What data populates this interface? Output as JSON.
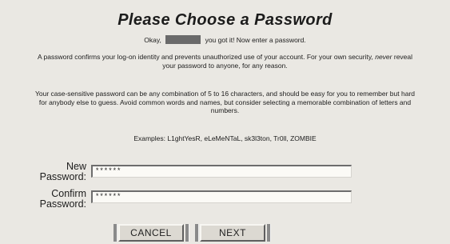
{
  "page": {
    "title": "Please Choose a Password",
    "greeting_prefix": "Okay,",
    "greeting_suffix": "you got it! Now enter a password.",
    "para1_part1": "A password confirms your log-on identity and prevents unauthorized use of your account. For your own security,",
    "para1_emphasis": "never",
    "para1_part2": "reveal your password to anyone, for any reason.",
    "para2": "Your case-sensitive password can be any combination of 5 to 16 characters, and should be easy for you to remember but hard for anybody else to guess. Avoid common words and names, but consider selecting a memorable combination of letters and numbers.",
    "examples_label": "Examples:",
    "examples_values": "L1ghtYesR, eLeMeNTaL, sk3l3ton, Tr0ll, ZOMBIE"
  },
  "form": {
    "new_password_label": "New Password:",
    "new_password_value": "******",
    "confirm_password_label": "Confirm Password:",
    "confirm_password_value": "******"
  },
  "buttons": {
    "cancel": "CANCEL",
    "next": "NEXT"
  }
}
